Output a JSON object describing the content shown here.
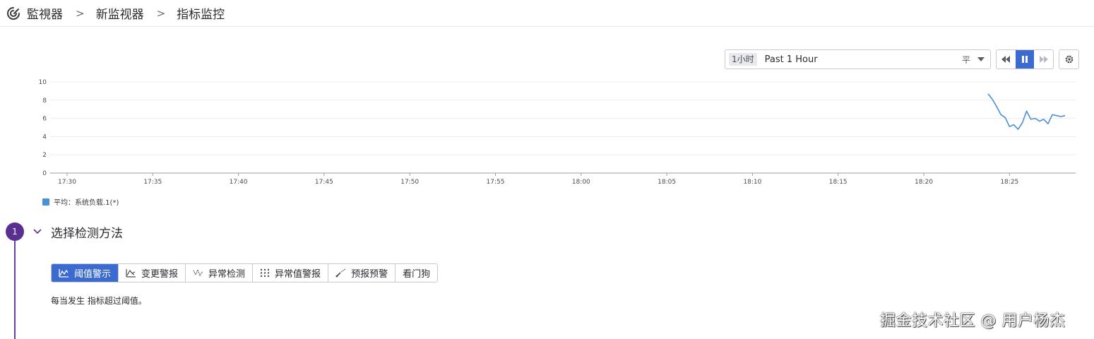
{
  "breadcrumb": {
    "items": [
      "監視器",
      "新监视器",
      "指标监控"
    ],
    "separator": ">"
  },
  "time_controls": {
    "badge": "1小时",
    "range_label": "Past 1 Hour",
    "aux_label": "平"
  },
  "chart_data": {
    "type": "line",
    "x_ticks": [
      "17:30",
      "17:35",
      "17:40",
      "17:45",
      "17:50",
      "17:55",
      "18:00",
      "18:05",
      "18:10",
      "18:15",
      "18:20",
      "18:25"
    ],
    "ylim": [
      0,
      10
    ],
    "y_ticks": [
      0,
      2,
      4,
      6,
      8,
      10
    ],
    "grid": true,
    "series": [
      {
        "name": "平均：系统负载.1(*)",
        "color": "#4a90d9",
        "x": [
          "18:23:45",
          "18:24:00",
          "18:24:15",
          "18:24:30",
          "18:24:45",
          "18:25:00",
          "18:25:15",
          "18:25:30",
          "18:25:45",
          "18:26:00",
          "18:26:15",
          "18:26:30",
          "18:26:45",
          "18:27:00",
          "18:27:15",
          "18:27:30",
          "18:27:45",
          "18:28:00",
          "18:28:15"
        ],
        "y": [
          8.7,
          8.1,
          7.3,
          6.4,
          6.1,
          5.1,
          5.3,
          4.8,
          5.5,
          6.8,
          5.9,
          6.0,
          5.7,
          5.9,
          5.4,
          6.4,
          6.3,
          6.2,
          6.3
        ]
      }
    ],
    "legend": "bottom-left"
  },
  "step": {
    "number": "1",
    "title": "选择检测方法"
  },
  "tabs": [
    {
      "label": "阈值警示",
      "icon": "threshold-icon",
      "active": true
    },
    {
      "label": "变更警报",
      "icon": "change-icon",
      "active": false
    },
    {
      "label": "异常检测",
      "icon": "anomaly-icon",
      "active": false
    },
    {
      "label": "异常值警报",
      "icon": "outlier-icon",
      "active": false
    },
    {
      "label": "预报预警",
      "icon": "forecast-icon",
      "active": false
    },
    {
      "label": "看门狗",
      "icon": "",
      "active": false
    }
  ],
  "description": "每当发生 指标超过阈值。",
  "watermark": "掘金技术社区 @ 用户杨杰",
  "colors": {
    "accent": "#3b6bd0",
    "step": "#5b2e91",
    "series": "#4a90d9"
  }
}
